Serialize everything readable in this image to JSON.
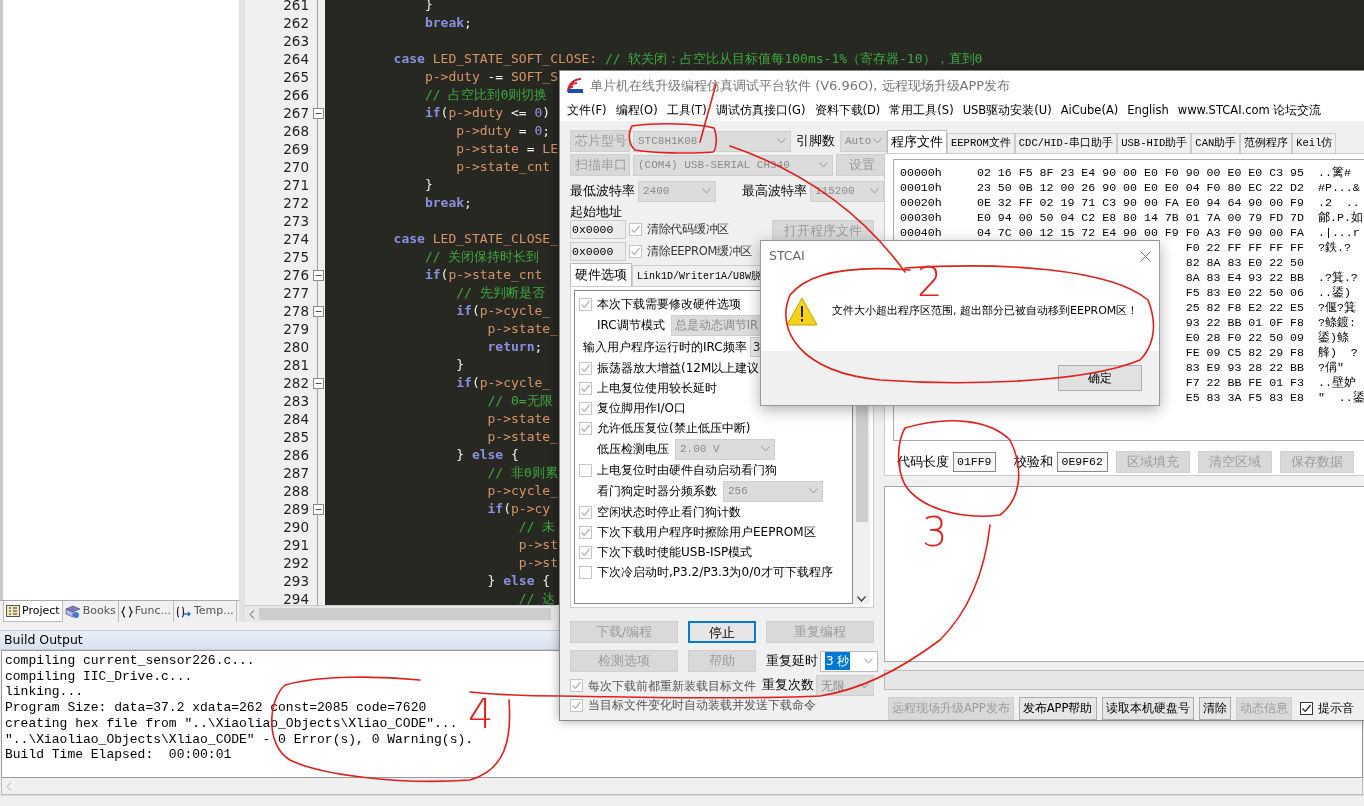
{
  "ide": {
    "editor": {
      "lines": [
        {
          "number": "261",
          "fold": false,
          "tokens": [
            {
              "kind": "plain",
              "text": "            }"
            }
          ]
        },
        {
          "number": "262",
          "fold": false,
          "tokens": [
            {
              "kind": "keyword",
              "text": "            break"
            },
            {
              "kind": "plain",
              "text": ";"
            }
          ]
        },
        {
          "number": "263",
          "fold": false
        },
        {
          "number": "264",
          "fold": false,
          "tokens": [
            {
              "kind": "keyword",
              "text": "        case"
            },
            {
              "kind": "var",
              "text": " LED_STATE_SOFT_CLOSE:"
            },
            {
              "kind": "comment",
              "text": " // 软关闭：占空比从目标值每100ms-1%（寄存器-10），直到0"
            }
          ]
        },
        {
          "number": "265",
          "fold": false,
          "tokens": [
            {
              "kind": "var",
              "text": "            p->duty"
            },
            {
              "kind": "plain",
              "text": " -= "
            },
            {
              "kind": "var",
              "text": "SOFT_S"
            }
          ]
        },
        {
          "number": "266",
          "fold": false,
          "tokens": [
            {
              "kind": "comment",
              "text": "            // 占空比到0则切换"
            }
          ]
        },
        {
          "number": "267",
          "fold": true,
          "tokens": [
            {
              "kind": "keyword",
              "text": "            if"
            },
            {
              "kind": "plain",
              "text": "("
            },
            {
              "kind": "var",
              "text": "p->duty"
            },
            {
              "kind": "plain",
              "text": " <= "
            },
            {
              "kind": "number",
              "text": "0"
            },
            {
              "kind": "plain",
              "text": ")"
            }
          ]
        },
        {
          "number": "268",
          "fold": false,
          "tokens": [
            {
              "kind": "var",
              "text": "                p->duty"
            },
            {
              "kind": "plain",
              "text": " = "
            },
            {
              "kind": "number",
              "text": "0"
            },
            {
              "kind": "plain",
              "text": ";"
            }
          ]
        },
        {
          "number": "269",
          "fold": false,
          "tokens": [
            {
              "kind": "var",
              "text": "                p->state"
            },
            {
              "kind": "plain",
              "text": " = "
            },
            {
              "kind": "var",
              "text": "LE"
            }
          ]
        },
        {
          "number": "270",
          "fold": false,
          "tokens": [
            {
              "kind": "var",
              "text": "                p->state_cnt"
            }
          ]
        },
        {
          "number": "271",
          "fold": false,
          "tokens": [
            {
              "kind": "plain",
              "text": "            }"
            }
          ]
        },
        {
          "number": "272",
          "fold": false,
          "tokens": [
            {
              "kind": "keyword",
              "text": "            break"
            },
            {
              "kind": "plain",
              "text": ";"
            }
          ]
        },
        {
          "number": "273",
          "fold": false
        },
        {
          "number": "274",
          "fold": false,
          "tokens": [
            {
              "kind": "keyword",
              "text": "        case"
            },
            {
              "kind": "var",
              "text": " LED_STATE_CLOSE_"
            }
          ]
        },
        {
          "number": "275",
          "fold": false,
          "tokens": [
            {
              "kind": "comment",
              "text": "            // 关闭保持时长到"
            }
          ]
        },
        {
          "number": "276",
          "fold": true,
          "tokens": [
            {
              "kind": "keyword",
              "text": "            if"
            },
            {
              "kind": "plain",
              "text": "("
            },
            {
              "kind": "var",
              "text": "p->state_cnt"
            }
          ]
        },
        {
          "number": "277",
          "fold": false,
          "tokens": [
            {
              "kind": "comment",
              "text": "                // 先判断是否"
            }
          ]
        },
        {
          "number": "278",
          "fold": true,
          "tokens": [
            {
              "kind": "keyword",
              "text": "                if"
            },
            {
              "kind": "plain",
              "text": "("
            },
            {
              "kind": "var",
              "text": "p->cycle_"
            }
          ]
        },
        {
          "number": "279",
          "fold": false,
          "tokens": [
            {
              "kind": "var",
              "text": "                    p->state_"
            }
          ]
        },
        {
          "number": "280",
          "fold": false,
          "tokens": [
            {
              "kind": "keyword",
              "text": "                    return"
            },
            {
              "kind": "plain",
              "text": ";"
            }
          ]
        },
        {
          "number": "281",
          "fold": false,
          "tokens": [
            {
              "kind": "plain",
              "text": "                }"
            }
          ]
        },
        {
          "number": "282",
          "fold": true,
          "tokens": [
            {
              "kind": "keyword",
              "text": "                if"
            },
            {
              "kind": "plain",
              "text": "("
            },
            {
              "kind": "var",
              "text": "p->cycle_"
            }
          ]
        },
        {
          "number": "283",
          "fold": false,
          "tokens": [
            {
              "kind": "comment",
              "text": "                    // 0=无限"
            }
          ]
        },
        {
          "number": "284",
          "fold": false,
          "tokens": [
            {
              "kind": "var",
              "text": "                    p->state"
            }
          ]
        },
        {
          "number": "285",
          "fold": false,
          "tokens": [
            {
              "kind": "var",
              "text": "                    p->state_"
            }
          ]
        },
        {
          "number": "286",
          "fold": false,
          "tokens": [
            {
              "kind": "plain",
              "text": "                } "
            },
            {
              "kind": "keyword",
              "text": "else"
            },
            {
              "kind": "plain",
              "text": " {"
            }
          ]
        },
        {
          "number": "287",
          "fold": false,
          "tokens": [
            {
              "kind": "comment",
              "text": "                    // 非0则累"
            }
          ]
        },
        {
          "number": "288",
          "fold": false,
          "tokens": [
            {
              "kind": "var",
              "text": "                    p->cycle_"
            }
          ]
        },
        {
          "number": "289",
          "fold": true,
          "tokens": [
            {
              "kind": "keyword",
              "text": "                    if"
            },
            {
              "kind": "plain",
              "text": "("
            },
            {
              "kind": "var",
              "text": "p->cy"
            }
          ]
        },
        {
          "number": "290",
          "fold": false,
          "tokens": [
            {
              "kind": "comment",
              "text": "                        // 未"
            }
          ]
        },
        {
          "number": "291",
          "fold": false,
          "tokens": [
            {
              "kind": "var",
              "text": "                        p->st"
            }
          ]
        },
        {
          "number": "292",
          "fold": false,
          "tokens": [
            {
              "kind": "var",
              "text": "                        p->st"
            }
          ]
        },
        {
          "number": "293",
          "fold": false,
          "tokens": [
            {
              "kind": "plain",
              "text": "                    } "
            },
            {
              "kind": "keyword",
              "text": "else"
            },
            {
              "kind": "plain",
              "text": " {"
            }
          ]
        },
        {
          "number": "294",
          "fold": false,
          "tokens": [
            {
              "kind": "comment",
              "text": "                        // 达"
            }
          ]
        }
      ]
    },
    "panel_tabs": [
      {
        "kind": "project",
        "label": "Project",
        "selected": true
      },
      {
        "kind": "books",
        "label": "Books",
        "selected": false
      },
      {
        "kind": "functions",
        "label": "Func...",
        "selected": false
      },
      {
        "kind": "templates",
        "label": "Temp...",
        "selected": false
      }
    ],
    "build_output": {
      "title": "Build Output",
      "lines": [
        "compiling current_sensor226.c...",
        "compiling IIC_Drive.c...",
        "linking...",
        "Program Size: data=37.2 xdata=262 const=2085 code=7620",
        "creating hex file from \"..\\Xiaoliao_Objects\\Xliao_CODE\"...",
        "\"..\\Xiaoliao_Objects\\Xliao_CODE\" - 0 Error(s), 0 Warning(s).",
        "Build Time Elapsed:  00:00:01"
      ]
    }
  },
  "programmer": {
    "title": "单片机在线升级编程仿真调试平台软件 (V6.96O), 远程现场升级APP发布",
    "menu": [
      "文件(F)",
      "编程(O)",
      "工具(T)",
      "调试仿真接口(G)",
      "资料下载(D)",
      "常用工具(S)",
      "USB驱动安装(U)",
      "AiCube(A)",
      "English",
      "www.STCAI.com 论坛交流"
    ],
    "chip": {
      "label": "芯片型号",
      "value": "STC8H1K08",
      "disabled": true
    },
    "pins": {
      "label": "引脚数",
      "value": "Auto",
      "disabled": true
    },
    "port": {
      "label": "扫描串口",
      "value": "(COM4) USB-SERIAL CH340",
      "button": "设置",
      "disabled": true
    },
    "min_baud": {
      "label": "最低波特率",
      "value": "2400",
      "disabled": true
    },
    "max_baud": {
      "label": "最高波特率",
      "value": "115200",
      "disabled": true
    },
    "start_address_label": "起始地址",
    "address_rows": [
      {
        "value": "0x0000",
        "option": "清除代码缓冲区",
        "checked": true
      },
      {
        "value": "0x0000",
        "option": "清除EEPROM缓冲区",
        "checked": true
      }
    ],
    "open_file_button": "打开程序文件",
    "option_tabs": [
      {
        "label": "硬件选项",
        "selected": true
      },
      {
        "label": "Link1D/Writer1A/U8W脱",
        "selected": false
      }
    ],
    "hardware_options": [
      {
        "kind": "checkbox",
        "label": "本次下载需要修改硬件选项",
        "checked": true
      },
      {
        "kind": "select",
        "label": "IRC调节模式",
        "value": "总是动态调节IR"
      },
      {
        "kind": "field",
        "label": "输入用户程序运行时的IRC频率",
        "value": "3"
      },
      {
        "kind": "checkbox",
        "label": "振荡器放大增益(12M以上建议",
        "checked": true
      },
      {
        "kind": "checkbox",
        "label": "上电复位使用较长延时",
        "checked": true
      },
      {
        "kind": "checkbox",
        "label": "复位脚用作I/O口",
        "checked": true
      },
      {
        "kind": "checkbox",
        "label": "允许低压复位(禁止低压中断)",
        "checked": true
      },
      {
        "kind": "select",
        "label": "低压检测电压",
        "value": "2.00 V"
      },
      {
        "kind": "checkbox",
        "label": "上电复位时由硬件自动启动看门狗",
        "checked": false
      },
      {
        "kind": "select",
        "label": "看门狗定时器分频系数",
        "value": "256"
      },
      {
        "kind": "checkbox",
        "label": "空闲状态时停止看门狗计数",
        "checked": true
      },
      {
        "kind": "checkbox",
        "label": "下次下载用户程序时擦除用户EEPROM区",
        "checked": true
      },
      {
        "kind": "checkbox",
        "label": "下次下载时使能USB-ISP模式",
        "checked": true
      },
      {
        "kind": "checkbox",
        "label": "下次冷启动时,P3.2/P3.3为0/0才可下载程序",
        "checked": false
      }
    ],
    "action_buttons": [
      {
        "label": "下载/编程",
        "disabled": true,
        "focused": false
      },
      {
        "label": "停止",
        "disabled": false,
        "focused": true
      },
      {
        "label": "重复编程",
        "disabled": true,
        "focused": false
      },
      {
        "label": "检测选项",
        "disabled": true,
        "focused": false
      },
      {
        "label": "帮助",
        "disabled": true,
        "focused": false
      }
    ],
    "repeat_delay": {
      "label": "重复延时",
      "value": "3 秒",
      "disabled": false,
      "highlighted": true
    },
    "repeat_count": {
      "label": "重复次数",
      "value": "无限",
      "disabled": true,
      "highlighted": false
    },
    "auto_options": [
      {
        "label": "每次下载前都重新装载目标文件",
        "checked": true
      },
      {
        "label": "当目标文件变化时自动装载并发送下载命令",
        "checked": true
      }
    ],
    "file_tabs": [
      {
        "label": "程序文件",
        "selected": true
      },
      {
        "label": "EEPROM文件",
        "selected": false
      },
      {
        "label": "CDC/HID-串口助手",
        "selected": false
      },
      {
        "label": "USB-HID助手",
        "selected": false
      },
      {
        "label": "CAN助手",
        "selected": false
      },
      {
        "label": "范例程序",
        "selected": false
      },
      {
        "label": "Keil仿",
        "selected": false
      }
    ],
    "hex_rows": [
      {
        "address": "00000h",
        "bytes": "02 16 F5 8F 23 E4 90 00 E0 F0 90 00 E0 E0 C3 95",
        "ascii": "..篱#"
      },
      {
        "address": "00010h",
        "bytes": "23 50 0B 12 00 26 90 00 E0 E0 04 F0 80 EC 22 D2",
        "ascii": "#P...&"
      },
      {
        "address": "00020h",
        "bytes": "0E 32 FF 02 19 71 C3 90 00 FA E0 94 64 90 00 F9",
        "ascii": ".2  .."
      },
      {
        "address": "00030h",
        "bytes": "E0 94 00 50 04 C2 E8 80 14 7B 01 7A 00 79 FD 7D",
        "ascii": "鄃.P.如"
      },
      {
        "address": "00040h",
        "bytes": "04 7C 00 12 15 72 E4 90 00 F9 F0 A3 F0 90 00 FA",
        "ascii": ".|...r"
      },
      {
        "bytes": "F0 22 FF FF FF FF",
        "ascii": "?鉄.?"
      },
      {
        "bytes": "82 8A 83 E0 22 50"
      },
      {
        "bytes": "8A 83 E4 93 22 BB",
        "ascii": ".?箕.?"
      },
      {
        "bytes": "F5 83 E0 22 50 06",
        "ascii": "..鋈)"
      },
      {
        "bytes": "25 82 F8 E2 22 E5",
        "ascii": "?偃?箕"
      },
      {
        "bytes": "93 22 BB 01 0F F8",
        "ascii": "?鲦鍍:"
      },
      {
        "bytes": "E0 28 F0 22 50 09",
        "ascii": "鋈)鲦"
      },
      {
        "bytes": "FE 09 C5 82 29 F8",
        "ascii": "艂)  ?"
      },
      {
        "bytes": "83 E9 93 28 22 BB",
        "ascii": "?偁\""
      },
      {
        "bytes": "F7 22 BB FE 01 F3",
        "ascii": "..壁妒"
      },
      {
        "bytes": "E5 83 3A F5 83 E8",
        "ascii": "\"  ..鋈"
      }
    ],
    "code_length": {
      "label": "代码长度",
      "value": "01FF9"
    },
    "checksum": {
      "label": "校验和",
      "value": "0E9F62"
    },
    "region_buttons": [
      {
        "label": "区域填充",
        "disabled": true
      },
      {
        "label": "清空区域",
        "disabled": true
      },
      {
        "label": "保存数据",
        "disabled": true
      }
    ],
    "bottom_buttons": [
      {
        "label": "远程现场升级APP发布",
        "disabled": true
      },
      {
        "label": "发布APP帮助",
        "disabled": false
      },
      {
        "label": "读取本机硬盘号",
        "disabled": false
      },
      {
        "label": "清除",
        "disabled": false
      },
      {
        "label": "动态信息",
        "disabled": true
      }
    ],
    "beep": {
      "label": "提示音",
      "checked": true
    }
  },
  "dialog": {
    "title": "STCAI",
    "message": "文件大小超出程序区范围, 超出部分已被自动移到EEPROM区！",
    "ok": "确定"
  },
  "annotations": [
    "2",
    "3",
    "4"
  ]
}
